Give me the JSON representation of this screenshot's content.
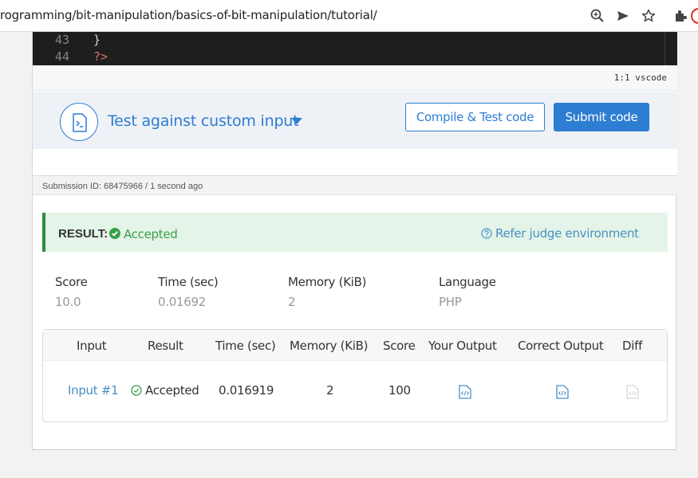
{
  "browser": {
    "url": "rogramming/bit-manipulation/basics-of-bit-manipulation/tutorial/",
    "icons": [
      "zoom-icon",
      "send-icon",
      "star-icon",
      "extensions-icon"
    ]
  },
  "editor": {
    "lines": [
      {
        "number": "43",
        "text": "}",
        "color": "#d4d4d4"
      },
      {
        "number": "44",
        "text": "?>",
        "color": "#e06c75"
      }
    ],
    "cursor_position": "1:1",
    "mode": "vscode"
  },
  "test_bar": {
    "label": "Test against custom input",
    "compile_button": "Compile & Test code",
    "submit_button": "Submit code"
  },
  "submission": {
    "id_text": "Submission ID: 68475966 / 1 second ago",
    "result_label": "RESULT:",
    "result_status": "Accepted",
    "judge_link": "Refer judge environment",
    "stats": [
      {
        "label": "Score",
        "value": "10.0"
      },
      {
        "label": "Time (sec)",
        "value": "0.01692"
      },
      {
        "label": "Memory (KiB)",
        "value": "2"
      },
      {
        "label": "Language",
        "value": "PHP"
      }
    ],
    "table": {
      "headers": [
        "Input",
        "Result",
        "Time (sec)",
        "Memory (KiB)",
        "Score",
        "Your Output",
        "Correct Output",
        "Diff"
      ],
      "rows": [
        {
          "input": "Input #1",
          "result": "Accepted",
          "time": "0.016919",
          "memory": "2",
          "score": "100"
        }
      ]
    }
  },
  "colors": {
    "accent": "#2d7dd2",
    "success": "#3aa04a",
    "success_bg": "#e4f4e8",
    "link": "#4a90c2"
  }
}
